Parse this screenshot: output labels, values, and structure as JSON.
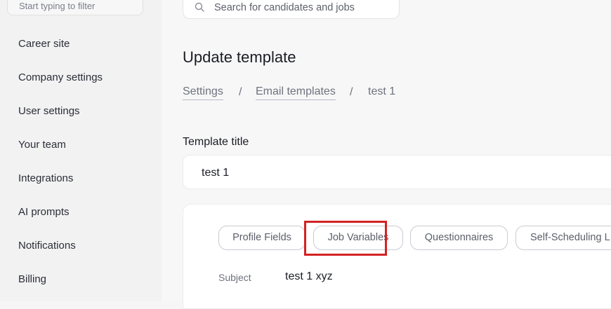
{
  "sidebar": {
    "filter_placeholder": "Start typing to filter",
    "items": [
      {
        "label": "Career site"
      },
      {
        "label": "Company settings"
      },
      {
        "label": "User settings"
      },
      {
        "label": "Your team"
      },
      {
        "label": "Integrations"
      },
      {
        "label": "AI prompts"
      },
      {
        "label": "Notifications"
      },
      {
        "label": "Billing"
      }
    ]
  },
  "header": {
    "search_placeholder": "Search for candidates and jobs",
    "search_icon": "search-icon"
  },
  "page": {
    "title": "Update template",
    "breadcrumb": [
      "Settings",
      "Email templates",
      "test 1"
    ],
    "breadcrumb_separator": "/"
  },
  "form": {
    "template_title_label": "Template title",
    "template_title_value": "test 1",
    "variable_tabs": [
      "Profile Fields",
      "Job Variables",
      "Questionnaires",
      "Self-Scheduling L"
    ],
    "subject_label": "Subject",
    "subject_value": "test 1 xyz"
  },
  "colors": {
    "highlight": "#d32222",
    "background": "#f7f7f8"
  }
}
